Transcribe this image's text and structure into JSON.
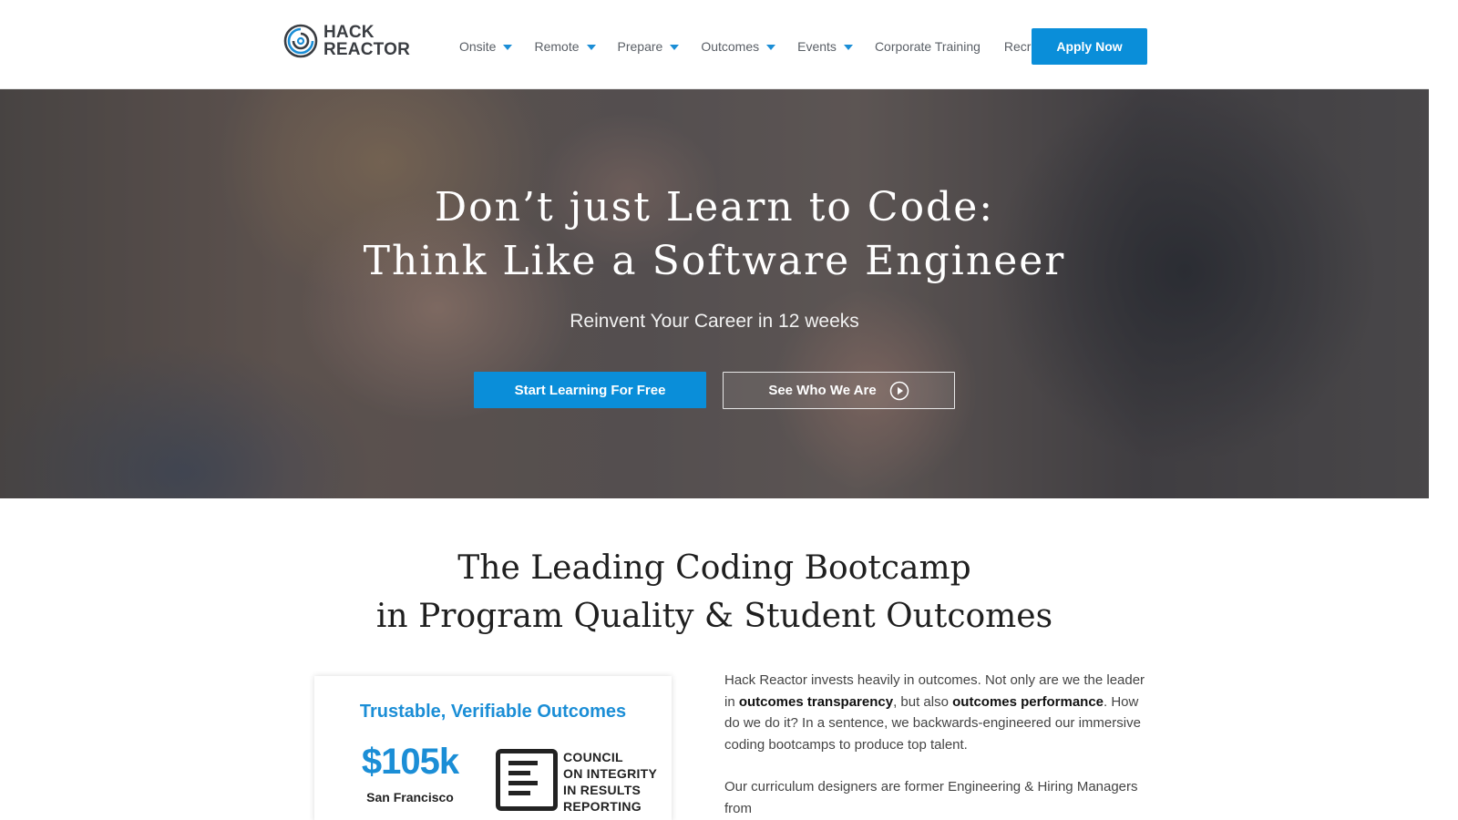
{
  "header": {
    "logo_line1": "HACK",
    "logo_line2": "REACTOR",
    "nav": [
      {
        "label": "Onsite",
        "has_dropdown": true
      },
      {
        "label": "Remote",
        "has_dropdown": true
      },
      {
        "label": "Prepare",
        "has_dropdown": true
      },
      {
        "label": "Outcomes",
        "has_dropdown": true
      },
      {
        "label": "Events",
        "has_dropdown": true
      },
      {
        "label": "Corporate Training",
        "has_dropdown": false
      },
      {
        "label": "Recruiting",
        "has_dropdown": false
      }
    ],
    "apply_label": "Apply Now"
  },
  "hero": {
    "title_line1": "Don’t just Learn to Code:",
    "title_line2": "Think Like a Software Engineer",
    "subtitle": "Reinvent Your Career in 12 weeks",
    "primary_cta": "Start Learning For Free",
    "secondary_cta": "See Who We Are"
  },
  "section": {
    "title_line1": "The Leading Coding Bootcamp",
    "title_line2": "in Program Quality & Student Outcomes"
  },
  "card": {
    "title": "Trustable, Verifiable Outcomes",
    "stat_value": "$105k",
    "stat_label": "San Francisco",
    "cirr_lines": [
      "COUNCIL",
      "ON INTEGRITY",
      "IN RESULTS",
      "REPORTING"
    ]
  },
  "body": {
    "p1_a": "Hack Reactor invests heavily in outcomes. Not only are we the leader in ",
    "p1_b": "outcomes transparency",
    "p1_c": ", but also ",
    "p1_d": "outcomes performance",
    "p1_e": ". How do we do it? In a sentence, we backwards-engineered our immersive coding bootcamps to produce top talent.",
    "p2": "Our curriculum designers are former Engineering & Hiring Managers from"
  },
  "colors": {
    "accent": "#0a8ed9",
    "text_dark": "#1f1f1f",
    "nav_text": "#5a5f66"
  },
  "icons": [
    "hack-reactor-logo-icon",
    "caret-down-icon",
    "play-circle-icon",
    "cirr-logo-icon"
  ]
}
